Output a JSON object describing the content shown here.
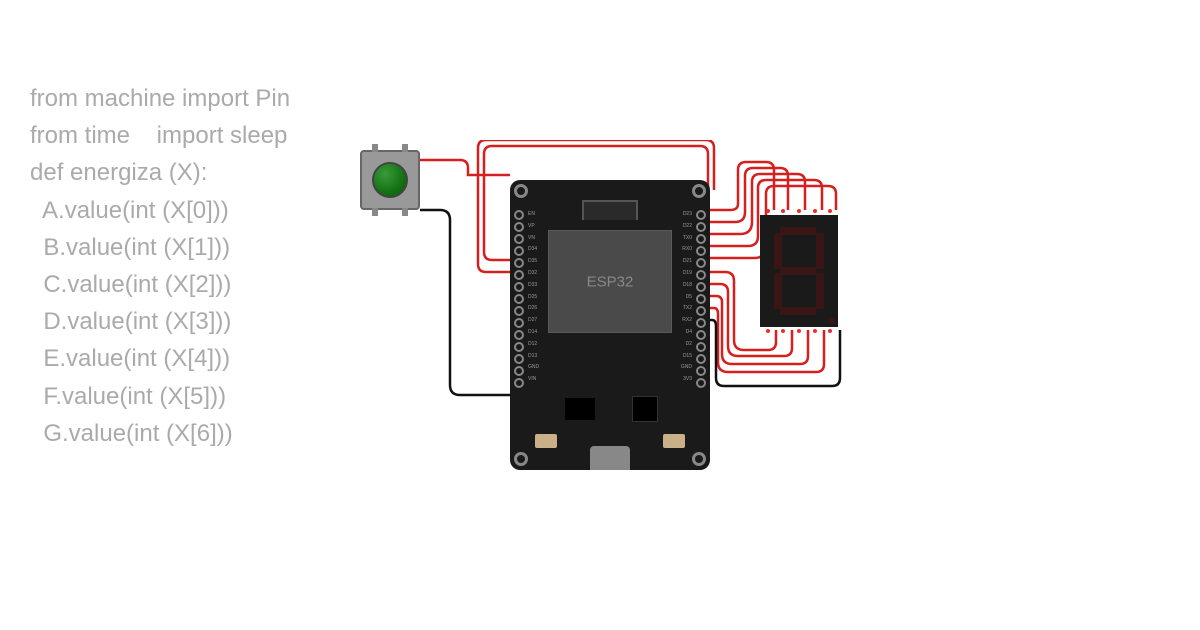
{
  "code": {
    "line1": "from machine import Pin",
    "line2": "from time    import sleep",
    "line3": "",
    "line4": "def energiza (X):",
    "line5": "",
    "line6": "  A.value(int (X[0]))",
    "line7": "  B.value(int (X[1]))",
    "line8": "  C.value(int (X[2]))",
    "line9": "  D.value(int (X[3]))",
    "line10": "  E.value(int (X[4]))",
    "line11": "  F.value(int (X[5]))",
    "line12": "  G.value(int (X[6]))"
  },
  "board": {
    "chip_label": "ESP32",
    "left_pins": [
      "EN",
      "VP",
      "VN",
      "D34",
      "D35",
      "D32",
      "D33",
      "D25",
      "D26",
      "D27",
      "D14",
      "D12",
      "D13",
      "GND",
      "VIN"
    ],
    "right_pins": [
      "D23",
      "D22",
      "TX0",
      "RX0",
      "D21",
      "D19",
      "D18",
      "D5",
      "TX2",
      "RX2",
      "D4",
      "D2",
      "D15",
      "GND",
      "3V3"
    ]
  },
  "components": {
    "button": "push-button-green",
    "display": "seven-segment"
  },
  "wire_colors": {
    "signal": "#d62020",
    "ground": "#111"
  }
}
